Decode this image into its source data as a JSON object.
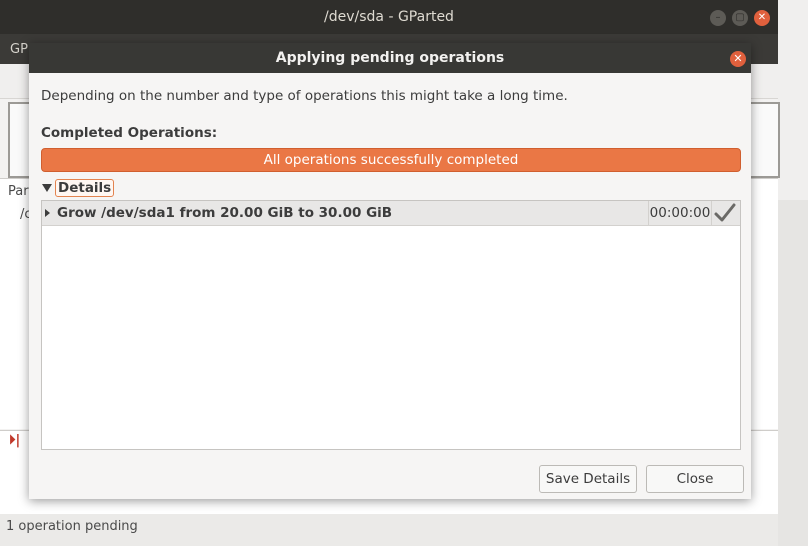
{
  "main_window": {
    "title": "/dev/sda - GParted",
    "menu_hint": "GP",
    "partition_header_hint": "Par",
    "partition_row_hint": "/c",
    "status_text": "1 operation pending"
  },
  "dialog": {
    "title": "Applying pending operations",
    "description": "Depending on the number and type of operations this might take a long time.",
    "completed_label": "Completed Operations:",
    "progress": {
      "text": "All operations successfully completed",
      "fraction": 1.0
    },
    "details": {
      "label": "Details",
      "expanded": true,
      "operations": [
        {
          "text": "Grow /dev/sda1 from 20.00 GiB to 30.00 GiB",
          "time": "00:00:00",
          "status_icon": "checkmark-icon"
        }
      ]
    },
    "buttons": {
      "save": "Save Details",
      "close": "Close"
    }
  },
  "colors": {
    "accent": "#ea7745",
    "titlebar": "#383835",
    "close_button": "#e0603d"
  }
}
